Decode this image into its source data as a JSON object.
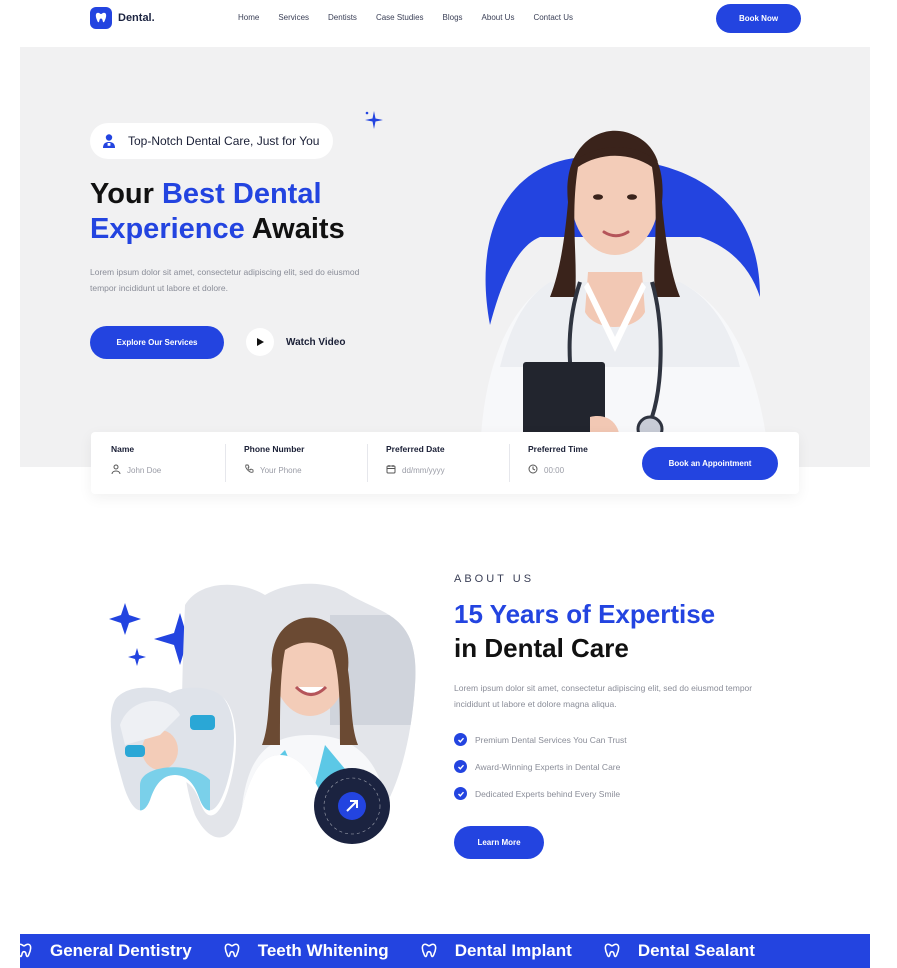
{
  "colors": {
    "accent": "#2344e0",
    "hero_bg": "#f1f1f2",
    "text": "#121212",
    "muted": "#8a8d98"
  },
  "nav": {
    "logo_text": "Dental.",
    "links": [
      "Home",
      "Services",
      "Dentists",
      "Case Studies",
      "Blogs",
      "About Us",
      "Contact Us"
    ],
    "cta": "Book Now"
  },
  "hero": {
    "badge_icon": "dentist-icon",
    "badge": "Top-Notch Dental Care, Just for You",
    "title_1": "Your ",
    "title_2": "Best Dental",
    "title_3": "Experience",
    "title_4": " Awaits",
    "description": "Lorem ipsum dolor sit amet, consectetur adipiscing elit, sed do eiusmod tempor incididunt ut labore et dolore.",
    "primary_cta": "Explore Our Services",
    "secondary_cta": "Watch Video"
  },
  "appointment": {
    "fields": [
      {
        "label": "Name",
        "placeholder": "John Doe",
        "icon": "user-icon"
      },
      {
        "label": "Phone Number",
        "placeholder": "Your Phone",
        "icon": "phone-icon"
      },
      {
        "label": "Preferred Date",
        "placeholder": "dd/mm/yyyy",
        "icon": "calendar-icon"
      },
      {
        "label": "Preferred Time",
        "placeholder": "00:00",
        "icon": "clock-icon"
      }
    ],
    "submit": "Book an Appointment"
  },
  "about": {
    "eyebrow": "ABOUT US",
    "title_blue": "15 Years of Expertise",
    "title_dark": "in Dental Care",
    "description": "Lorem ipsum dolor sit amet, consectetur adipiscing elit, sed do eiusmod tempor incididunt ut labore et dolore magna aliqua.",
    "checks": [
      "Premium Dental Services You Can Trust",
      "Award-Winning Experts in Dental Care",
      "Dedicated Experts behind Every Smile"
    ],
    "cta": "Learn More",
    "badge_text": "CONTACT • CONTACT •"
  },
  "marquee": {
    "items": [
      "General Dentistry",
      "Teeth Whitening",
      "Dental Implant",
      "Dental Sealant"
    ]
  }
}
